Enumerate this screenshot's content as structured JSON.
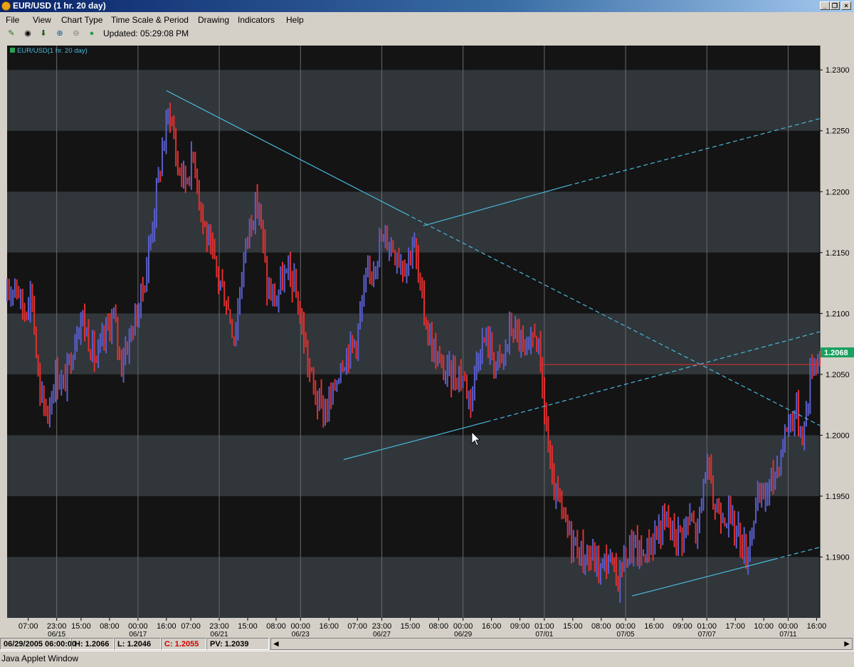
{
  "window": {
    "title": "EUR/USD (1 hr. 20 day)"
  },
  "menu": [
    "File",
    "View",
    "Chart Type",
    "Time Scale & Period",
    "Drawing",
    "Indicators",
    "Help"
  ],
  "toolbar": {
    "icons": [
      "trendline-pen-icon",
      "target-icon",
      "download-arrow-icon",
      "zoom-in-icon",
      "zoom-out-icon",
      "refresh-dot-icon"
    ],
    "updated": "Updated: 05:29:08 PM"
  },
  "colors": {
    "background": "#141414",
    "band": "#30363a",
    "candle_up": "#5a5ecc",
    "candle_down": "#e03030",
    "trendline": "#4ab8dc",
    "price_label": "#1aa060"
  },
  "chart_data": {
    "type": "candlestick",
    "legend": "EUR/USD(1 hr. 20 day)",
    "current_price": "1.2068",
    "ylim": [
      1.185,
      1.232
    ],
    "yticks": [
      "1.2300",
      "1.2250",
      "1.2200",
      "1.2150",
      "1.2100",
      "1.2050",
      "1.2000",
      "1.1950",
      "1.1900"
    ],
    "yvalues": [
      1.23,
      1.225,
      1.22,
      1.215,
      1.21,
      1.205,
      1.2,
      1.195,
      1.19
    ],
    "x_index_range": [
      0,
      100
    ],
    "xticks": [
      {
        "i": 2.6,
        "time": "07:00",
        "date": ""
      },
      {
        "i": 6.1,
        "time": "23:00",
        "date": "06/15"
      },
      {
        "i": 9.1,
        "time": "15:00",
        "date": ""
      },
      {
        "i": 12.6,
        "time": "08:00",
        "date": ""
      },
      {
        "i": 16.1,
        "time": "00:00",
        "date": "06/17"
      },
      {
        "i": 19.6,
        "time": "16:00",
        "date": ""
      },
      {
        "i": 22.6,
        "time": "07:00",
        "date": ""
      },
      {
        "i": 26.1,
        "time": "23:00",
        "date": "06/21"
      },
      {
        "i": 29.6,
        "time": "15:00",
        "date": ""
      },
      {
        "i": 33.1,
        "time": "08:00",
        "date": ""
      },
      {
        "i": 36.1,
        "time": "00:00",
        "date": "06/23"
      },
      {
        "i": 39.6,
        "time": "16:00",
        "date": ""
      },
      {
        "i": 43.1,
        "time": "07:00",
        "date": ""
      },
      {
        "i": 46.1,
        "time": "23:00",
        "date": "06/27"
      },
      {
        "i": 49.6,
        "time": "15:00",
        "date": ""
      },
      {
        "i": 53.1,
        "time": "08:00",
        "date": ""
      },
      {
        "i": 56.1,
        "time": "00:00",
        "date": "06/29"
      },
      {
        "i": 59.6,
        "time": "16:00",
        "date": ""
      },
      {
        "i": 63.1,
        "time": "09:00",
        "date": ""
      },
      {
        "i": 66.1,
        "time": "01:00",
        "date": "07/01"
      },
      {
        "i": 69.6,
        "time": "15:00",
        "date": ""
      },
      {
        "i": 73.1,
        "time": "08:00",
        "date": ""
      },
      {
        "i": 76.1,
        "time": "00:00",
        "date": "07/05"
      },
      {
        "i": 79.6,
        "time": "16:00",
        "date": ""
      },
      {
        "i": 83.1,
        "time": "09:00",
        "date": ""
      },
      {
        "i": 86.1,
        "time": "01:00",
        "date": "07/07"
      },
      {
        "i": 89.6,
        "time": "17:00",
        "date": ""
      },
      {
        "i": 93.1,
        "time": "10:00",
        "date": ""
      },
      {
        "i": 96.1,
        "time": "00:00",
        "date": "07/11"
      },
      {
        "i": 99.6,
        "time": "16:00",
        "date": ""
      }
    ],
    "vgrid_indices": [
      6.1,
      16.1,
      26.1,
      36.1,
      46.1,
      56.1,
      66.1,
      76.1,
      86.1,
      96.1
    ],
    "price_path": [
      [
        0,
        1.211
      ],
      [
        1,
        1.213
      ],
      [
        2,
        1.21
      ],
      [
        3,
        1.212
      ],
      [
        4,
        1.203
      ],
      [
        5,
        1.202
      ],
      [
        6,
        1.205
      ],
      [
        7,
        1.204
      ],
      [
        8,
        1.207
      ],
      [
        9,
        1.21
      ],
      [
        10,
        1.208
      ],
      [
        11,
        1.206
      ],
      [
        12,
        1.208
      ],
      [
        13,
        1.21
      ],
      [
        14,
        1.206
      ],
      [
        15,
        1.208
      ],
      [
        16,
        1.21
      ],
      [
        17,
        1.213
      ],
      [
        18,
        1.218
      ],
      [
        19,
        1.223
      ],
      [
        20,
        1.227
      ],
      [
        21,
        1.222
      ],
      [
        22,
        1.221
      ],
      [
        23,
        1.223
      ],
      [
        24,
        1.218
      ],
      [
        25,
        1.215
      ],
      [
        26,
        1.213
      ],
      [
        27,
        1.211
      ],
      [
        28,
        1.208
      ],
      [
        29,
        1.214
      ],
      [
        30,
        1.218
      ],
      [
        31,
        1.219
      ],
      [
        32,
        1.212
      ],
      [
        33,
        1.211
      ],
      [
        34,
        1.213
      ],
      [
        35,
        1.213
      ],
      [
        36,
        1.21
      ],
      [
        37,
        1.206
      ],
      [
        38,
        1.203
      ],
      [
        39,
        1.202
      ],
      [
        40,
        1.203
      ],
      [
        41,
        1.206
      ],
      [
        42,
        1.207
      ],
      [
        43,
        1.208
      ],
      [
        44,
        1.212
      ],
      [
        45,
        1.214
      ],
      [
        46,
        1.216
      ],
      [
        47,
        1.216
      ],
      [
        48,
        1.215
      ],
      [
        49,
        1.214
      ],
      [
        50,
        1.216
      ],
      [
        51,
        1.211
      ],
      [
        52,
        1.208
      ],
      [
        53,
        1.206
      ],
      [
        54,
        1.205
      ],
      [
        55,
        1.205
      ],
      [
        56,
        1.205
      ],
      [
        57,
        1.203
      ],
      [
        58,
        1.207
      ],
      [
        59,
        1.208
      ],
      [
        60,
        1.206
      ],
      [
        61,
        1.206
      ],
      [
        62,
        1.209
      ],
      [
        63,
        1.208
      ],
      [
        64,
        1.206
      ],
      [
        65,
        1.209
      ],
      [
        66,
        1.203
      ],
      [
        67,
        1.196
      ],
      [
        68,
        1.194
      ],
      [
        69,
        1.192
      ],
      [
        70,
        1.191
      ],
      [
        71,
        1.19
      ],
      [
        72,
        1.19
      ],
      [
        73,
        1.189
      ],
      [
        74,
        1.19
      ],
      [
        75,
        1.188
      ],
      [
        76,
        1.19
      ],
      [
        77,
        1.191
      ],
      [
        78,
        1.19
      ],
      [
        79,
        1.191
      ],
      [
        80,
        1.192
      ],
      [
        81,
        1.193
      ],
      [
        82,
        1.192
      ],
      [
        83,
        1.192
      ],
      [
        84,
        1.193
      ],
      [
        85,
        1.192
      ],
      [
        86,
        1.198
      ],
      [
        87,
        1.194
      ],
      [
        88,
        1.194
      ],
      [
        89,
        1.193
      ],
      [
        90,
        1.192
      ],
      [
        91,
        1.19
      ],
      [
        92,
        1.194
      ],
      [
        93,
        1.195
      ],
      [
        94,
        1.196
      ],
      [
        95,
        1.198
      ],
      [
        96,
        1.201
      ],
      [
        97,
        1.202
      ],
      [
        98,
        1.2
      ],
      [
        99,
        1.206
      ],
      [
        100,
        1.2067
      ]
    ],
    "trendlines": [
      {
        "from": [
          19.6,
          1.2283
        ],
        "to": [
          49.0,
          1.2182
        ],
        "style": "solid"
      },
      {
        "from": [
          49.0,
          1.2182
        ],
        "to": [
          100.0,
          1.2008
        ],
        "style": "dashed"
      },
      {
        "from": [
          41.4,
          1.198
        ],
        "to": [
          59.0,
          1.2011
        ],
        "style": "solid"
      },
      {
        "from": [
          59.0,
          1.2011
        ],
        "to": [
          100.0,
          1.2085
        ],
        "style": "dashed"
      },
      {
        "from": [
          51.2,
          1.2172
        ],
        "to": [
          69.0,
          1.2205
        ],
        "style": "solid"
      },
      {
        "from": [
          69.0,
          1.2205
        ],
        "to": [
          100.0,
          1.226
        ],
        "style": "dashed"
      },
      {
        "from": [
          76.9,
          1.1868
        ],
        "to": [
          94.3,
          1.1898
        ],
        "style": "solid"
      },
      {
        "from": [
          94.3,
          1.1898
        ],
        "to": [
          100.0,
          1.1908
        ],
        "style": "dashed"
      }
    ],
    "horizontal_line": {
      "from_index": 65.5,
      "to_index": 100,
      "y": 1.2058
    },
    "grid": true
  },
  "status": {
    "datetime": "06/29/2005 06:00:00",
    "high": "H: 1.2066",
    "low": "L: 1.2046",
    "close": "C: 1.2055",
    "pv": "PV: 1.2039"
  },
  "footer": "Java Applet Window"
}
